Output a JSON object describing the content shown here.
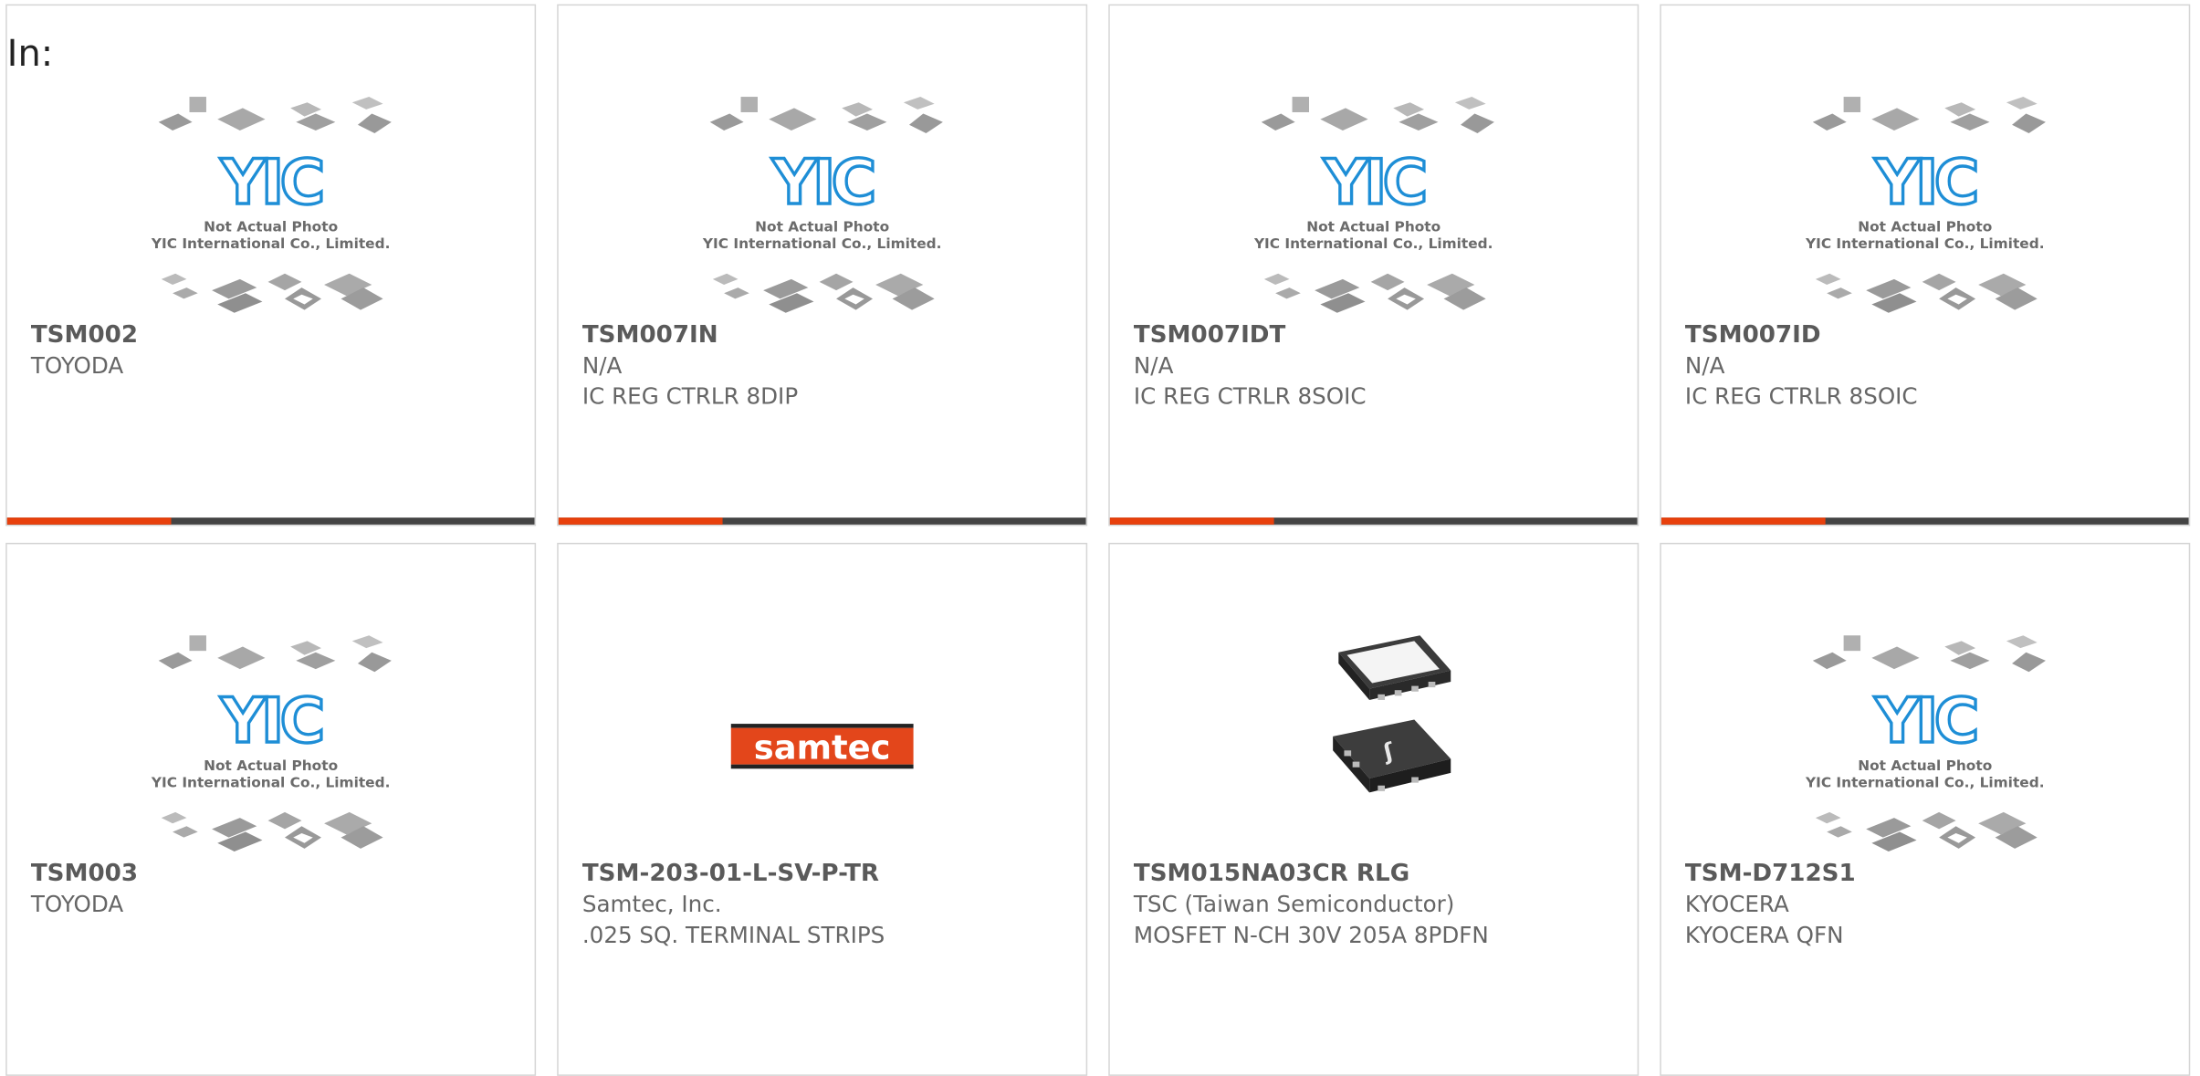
{
  "header": {
    "in_label": "In:"
  },
  "placeholder": {
    "line1": "Not Actual Photo",
    "line2": "YIC International Co., Limited."
  },
  "samtec_logo_text": "samtec",
  "cards": [
    {
      "part": "TSM002",
      "maker": "TOYODA",
      "desc": "",
      "image": "placeholder",
      "progress": 0.31
    },
    {
      "part": "TSM007IN",
      "maker": "N/A",
      "desc": "IC REG CTRLR 8DIP",
      "image": "placeholder",
      "progress": 0.31
    },
    {
      "part": "TSM007IDT",
      "maker": "N/A",
      "desc": "IC REG CTRLR 8SOIC",
      "image": "placeholder",
      "progress": 0.31
    },
    {
      "part": "TSM007ID",
      "maker": "N/A",
      "desc": "IC REG CTRLR 8SOIC",
      "image": "placeholder",
      "progress": 0.31
    },
    {
      "part": "TSM003",
      "maker": "TOYODA",
      "desc": "",
      "image": "placeholder"
    },
    {
      "part": "TSM-203-01-L-SV-P-TR",
      "maker": "Samtec, Inc.",
      "desc": ".025 SQ. TERMINAL STRIPS",
      "image": "samtec-logo"
    },
    {
      "part": "TSM015NA03CR RLG",
      "maker": "TSC (Taiwan Semiconductor)",
      "desc": "MOSFET N-CH 30V 205A 8PDFN",
      "image": "pdfn-package"
    },
    {
      "part": "TSM-D712S1",
      "maker": "KYOCERA",
      "desc": "KYOCERA QFN",
      "image": "placeholder"
    }
  ],
  "colors": {
    "accent": "#e8400c",
    "bar": "#444444",
    "yic_blue": "#1e8ed6"
  }
}
